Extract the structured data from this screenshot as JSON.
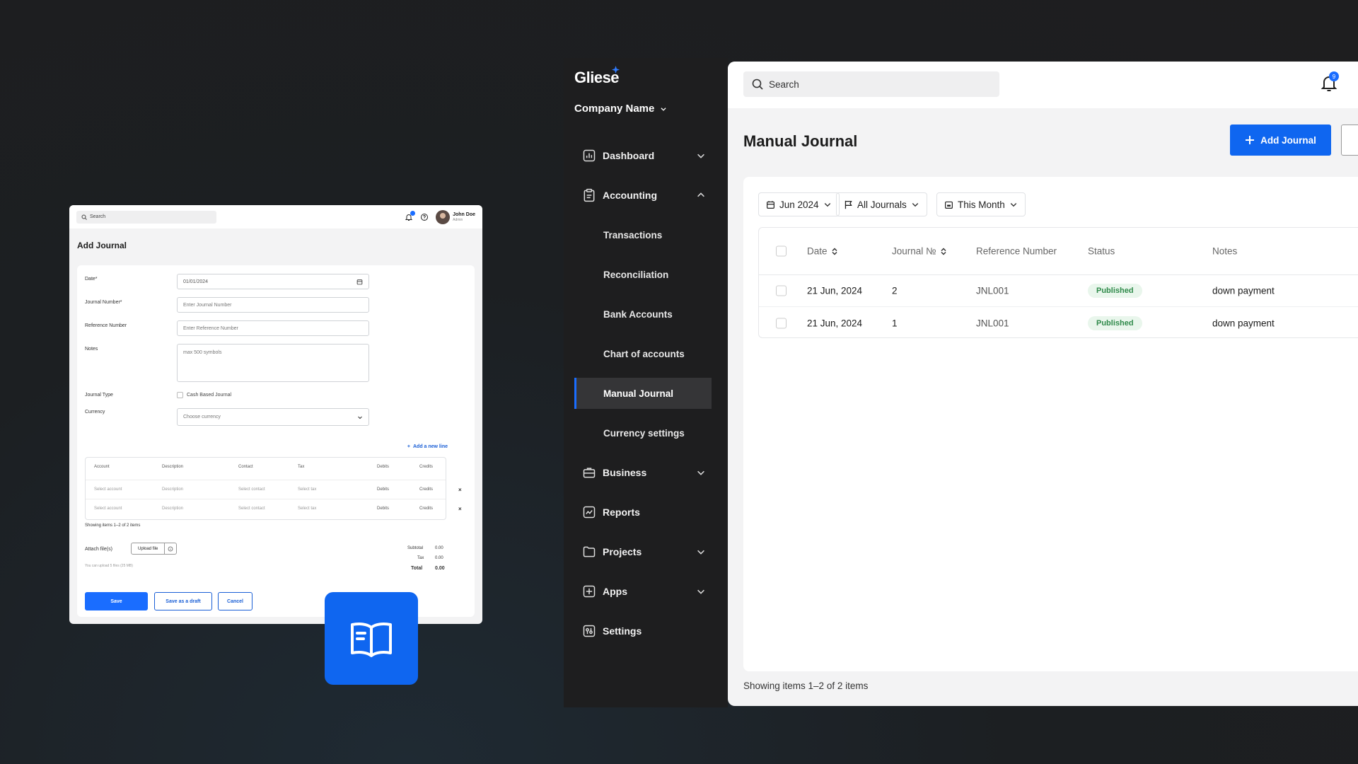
{
  "mini_window": {
    "search_placeholder": "Search",
    "user_name": "John Doe",
    "user_role": "Admin",
    "title": "Add Journal",
    "form": {
      "date_label": "Date*",
      "date_value": "01/01/2024",
      "journal_number_label": "Journal Number*",
      "journal_number_placeholder": "Enter Journal Number",
      "reference_label": "Reference Number",
      "reference_placeholder": "Enter Reference Number",
      "notes_label": "Notes",
      "notes_placeholder": "max 500 symbols",
      "journal_type_label": "Journal Type",
      "cash_based_label": "Cash Based Journal",
      "currency_label": "Currency",
      "currency_placeholder": "Choose currency"
    },
    "add_line": "Add a new line",
    "table": {
      "headers": [
        "Account",
        "Description",
        "Contact",
        "Tax",
        "Debits",
        "Credits"
      ],
      "rows": [
        [
          "Select account",
          "Description",
          "Select contact",
          "Select tax",
          "Debits",
          "Credits"
        ],
        [
          "Select account",
          "Description",
          "Select contact",
          "Select tax",
          "Debits",
          "Credits"
        ]
      ],
      "showing": "Showing items 1–2 of 2 items"
    },
    "attach_label": "Attach file(s)",
    "upload_label": "Upload file",
    "upload_hint": "You can upload 5 files (25 MB)",
    "totals": {
      "subtotal_label": "Subtotal",
      "subtotal": "0.00",
      "tax_label": "Tax",
      "tax": "0.00",
      "total_label": "Total",
      "total": "0.00"
    },
    "buttons": {
      "save": "Save",
      "draft": "Save as a draft",
      "cancel": "Cancel"
    }
  },
  "sidebar": {
    "logo": "Gliese",
    "company": "Company Name",
    "items": [
      {
        "label": "Dashboard",
        "icon": "chart-icon"
      },
      {
        "label": "Accounting",
        "icon": "clipboard-icon"
      },
      {
        "label": "Business",
        "icon": "briefcase-icon"
      },
      {
        "label": "Reports",
        "icon": "trend-icon"
      },
      {
        "label": "Projects",
        "icon": "folder-icon"
      },
      {
        "label": "Apps",
        "icon": "grid-icon"
      },
      {
        "label": "Settings",
        "icon": "sliders-icon"
      }
    ],
    "accounting_sub": [
      "Transactions",
      "Reconciliation",
      "Bank Accounts",
      "Chart of accounts",
      "Manual Journal",
      "Currency settings"
    ],
    "active_item": "Manual Journal"
  },
  "header": {
    "search_placeholder": "Search",
    "notification_count": "9"
  },
  "main": {
    "title": "Manual Journal",
    "add_button": "Add Journal",
    "filters": [
      "Jun 2024",
      "All Journals",
      "This Month"
    ],
    "table": {
      "headers": [
        "Date",
        "Journal №",
        "Reference Number",
        "Status",
        "Notes"
      ],
      "rows": [
        {
          "date": "21 Jun, 2024",
          "journal": "2",
          "reference": "JNL001",
          "status": "Published",
          "notes": "down payment"
        },
        {
          "date": "21 Jun, 2024",
          "journal": "1",
          "reference": "JNL001",
          "status": "Published",
          "notes": "down payment"
        }
      ]
    },
    "footer": "Showing items 1–2 of 2 items"
  },
  "colors": {
    "accent": "#0f66f0",
    "sidebar_bg": "#1e1e1f",
    "status_green": "#2f8a4a"
  }
}
